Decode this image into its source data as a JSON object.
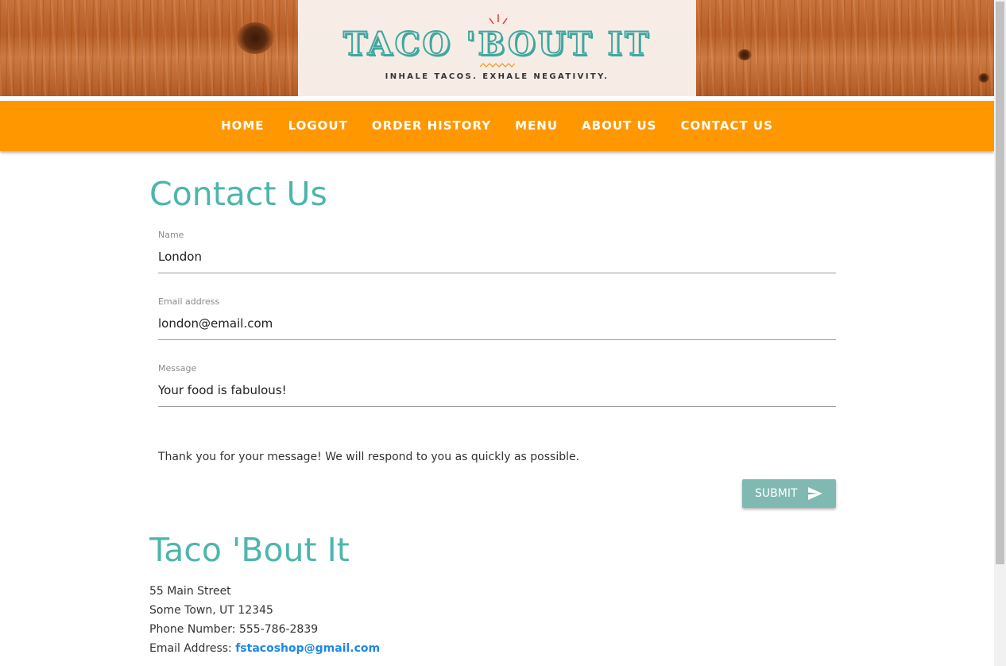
{
  "brand": {
    "name": "TACO 'BOUT IT",
    "tagline": "INHALE TACOS. EXHALE NEGATIVITY."
  },
  "nav": {
    "items": [
      {
        "label": "HOME"
      },
      {
        "label": "LOGOUT"
      },
      {
        "label": "ORDER HISTORY"
      },
      {
        "label": "MENU"
      },
      {
        "label": "ABOUT US"
      },
      {
        "label": "CONTACT US"
      }
    ]
  },
  "contact_form": {
    "title": "Contact Us",
    "name_label": "Name",
    "name_value": "London",
    "email_label": "Email address",
    "email_value": "london@email.com",
    "message_label": "Message",
    "message_value": "Your food is fabulous!",
    "confirmation": "Thank you for your message! We will respond to you as quickly as possible.",
    "submit_label": "SUBMIT",
    "submit_icon": "send-icon"
  },
  "footer": {
    "title": "Taco 'Bout It",
    "address_line1": "55 Main Street",
    "address_line2": "Some Town, UT 12345",
    "phone_text": "Phone Number: 555-786-2839",
    "email_prefix": "Email Address: ",
    "email": "fstacoshop@gmail.com"
  },
  "colors": {
    "nav_bg": "#ff9800",
    "heading": "#4db6ac",
    "button_bg": "#80b9b2",
    "link": "#1e88e5",
    "logo_teal": "#3ea8a0"
  }
}
